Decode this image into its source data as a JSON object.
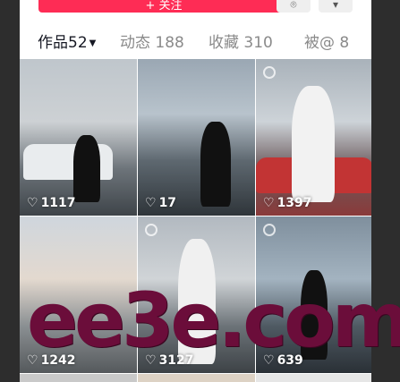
{
  "header": {
    "follow_label": "+ 关注",
    "icon_names": [
      "location-icon",
      "more-icon"
    ]
  },
  "tabs": [
    {
      "label": "作品",
      "count": "52",
      "active": true
    },
    {
      "label": "动态",
      "count": "188",
      "active": false
    },
    {
      "label": "收藏",
      "count": "310",
      "active": false
    },
    {
      "label": "被@",
      "count": "8",
      "active": false
    }
  ],
  "grid": {
    "tiles": [
      {
        "likes": "1117"
      },
      {
        "likes": "17"
      },
      {
        "likes": "1397"
      },
      {
        "likes": "1242"
      },
      {
        "likes": "3127"
      },
      {
        "likes": "639"
      }
    ]
  },
  "watermark": "ee3e.com",
  "colors": {
    "accent": "#fe2c55",
    "watermark": "#6b0d3a"
  }
}
